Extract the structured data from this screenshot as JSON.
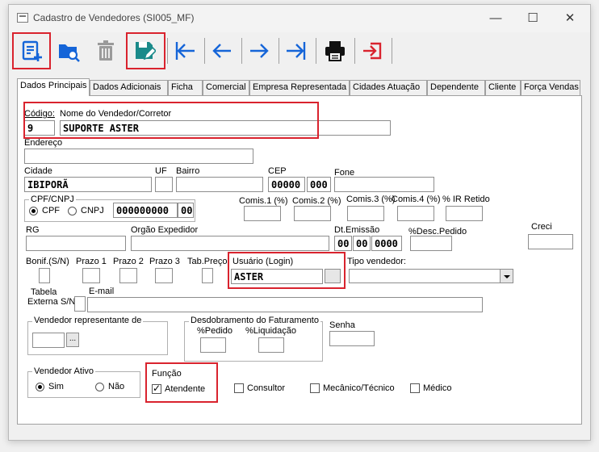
{
  "window": {
    "title": "Cadastro de Vendedores (SI005_MF)",
    "minimize": "—",
    "maximize": "☐",
    "close": "✕"
  },
  "toolbar": {
    "buttons": [
      "new-record",
      "search-record",
      "delete-record",
      "edit-save-record",
      "first-record",
      "previous-record",
      "next-record",
      "last-record",
      "print",
      "exit"
    ]
  },
  "tabs": [
    "Dados Principais",
    "Dados Adicionais",
    "Ficha",
    "Comercial",
    "Empresa Representada",
    "Cidades Atuação",
    "Dependente",
    "Cliente",
    "Força Vendas"
  ],
  "form": {
    "codigo_label": "Código:",
    "codigo_value": "9",
    "nome_label": "Nome do Vendedor/Corretor",
    "nome_value": "SUPORTE ASTER",
    "endereco_label": "Endereço",
    "endereco_value": "",
    "cidade_label": "Cidade",
    "cidade_value": "IBIPORÃ",
    "uf_label": "UF",
    "uf_value": "",
    "bairro_label": "Bairro",
    "bairro_value": "",
    "cep_label": "CEP",
    "cep_part1": "00000",
    "cep_part2": "000",
    "fone_label": "Fone",
    "fone_value": "",
    "cpf_group_label": "CPF/CNPJ",
    "cpf_option": "CPF",
    "cnpj_option": "CNPJ",
    "cpf_part1": "000000000",
    "cpf_part2": "00",
    "comis1_label": "Comis.1 (%)",
    "comis2_label": "Comis.2 (%)",
    "comis3_label": "Comis.3 (%)",
    "comis4_label": "Comis.4 (%)",
    "ir_label": "% IR Retido",
    "rg_label": "RG",
    "orgao_label": "Orgão Expedidor",
    "dt_emissao_label": "Dt.Emissão",
    "dt_day": "00",
    "dt_month": "00",
    "dt_year": "0000",
    "desc_pedido_label": "%Desc.Pedido",
    "creci_label": "Creci",
    "bonif_label": "Bonif.(S/N)",
    "prazo1_label": "Prazo 1",
    "prazo2_label": "Prazo 2",
    "prazo3_label": "Prazo 3",
    "tab_preco_label": "Tab.Preço",
    "usuario_label": "Usuário (Login)",
    "usuario_value": "ASTER",
    "tipo_vendedor_label": "Tipo vendedor:",
    "tabela_externa_label_1": "Tabela",
    "tabela_externa_label_2": "Externa S/N",
    "email_label": "E-mail",
    "vend_rep_label": "Vendedor representante de",
    "vend_rep_button": "...",
    "desdobramento_label": "Desdobramento do Faturamento",
    "pct_pedido_label": "%Pedido",
    "pct_liquidacao_label": "%Liquidação",
    "senha_label": "Senha",
    "vend_ativo_label": "Vendedor Ativo",
    "sim_label": "Sim",
    "nao_label": "Não",
    "funcao_label": "Função",
    "atendente_label": "Atendente",
    "consultor_label": "Consultor",
    "mecanico_label": "Mecânico/Técnico",
    "medico_label": "Médico"
  },
  "colors": {
    "accent_blue": "#1565d8",
    "teal": "#1a8a8a",
    "highlight_red": "#d9232e",
    "trash_gray": "#9a9a9a"
  }
}
